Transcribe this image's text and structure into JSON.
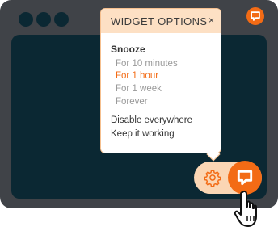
{
  "popup": {
    "title": "WIDGET OPTIONS",
    "close_label": "×",
    "section_title": "Snooze",
    "snooze_options": [
      {
        "label": "For 10 minutes"
      },
      {
        "label": "For 1 hour"
      },
      {
        "label": "For 1 week"
      },
      {
        "label": "Forever"
      }
    ],
    "selected_snooze": "For 1 hour",
    "actions": [
      {
        "label": "Disable everywhere"
      },
      {
        "label": "Keep it working"
      }
    ]
  },
  "icons": {
    "window_dots": [
      "window-dot",
      "window-dot",
      "window-dot"
    ],
    "corner": "chat-icon",
    "settings": "gear-icon",
    "chat": "chat-icon",
    "cursor": "hand-pointer-icon"
  },
  "colors": {
    "frame": "#404348",
    "content": "#0b2833",
    "accent": "#f36b15",
    "popup_header": "#fde0c4",
    "pill": "#fbd6b4"
  }
}
